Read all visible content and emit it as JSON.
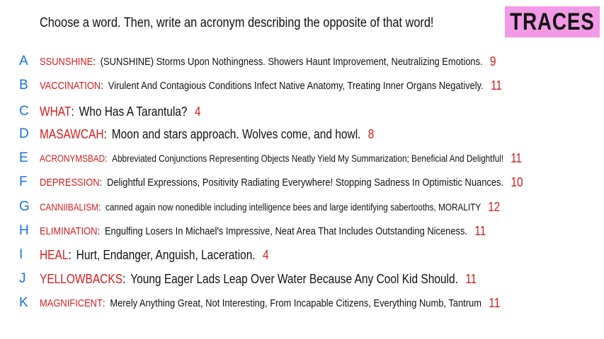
{
  "prompt": "Choose a word. Then, write an acronym describing the opposite of that word!",
  "badge": "TRACES",
  "colors": {
    "letter": "#1673e0",
    "word": "#d81c1c",
    "count": "#d81c1c",
    "badge_bg": "#f29ae6",
    "text": "#111111"
  },
  "rows": [
    {
      "letter": "A",
      "word": "SSUNSHINE",
      "text": "(SUNSHINE) Storms Upon Nothingness. Showers Haunt Improvement, Neutralizing Emotions.",
      "count": "9"
    },
    {
      "letter": "B",
      "word": "VACCINATION",
      "text": "Virulent And Contagious Conditions Infect Native Anatomy, Treating Inner Organs Negatively.",
      "count": "11"
    },
    {
      "letter": "C",
      "word": "WHAT",
      "text": "Who Has A Tarantula?",
      "count": "4"
    },
    {
      "letter": "D",
      "word": "MASAWCAH",
      "text": "Moon and stars approach. Wolves come, and howl.",
      "count": "8"
    },
    {
      "letter": "E",
      "word": "ACRONYMSBAD",
      "text": "Abbreviated Conjunctions Representing Objects Neatly Yield My Summarization; Beneficial And Delightful!",
      "count": "11"
    },
    {
      "letter": "F",
      "word": "DEPRESSION",
      "text": "Delightful Expressions, Positivity Radiating Everywhere! Stopping Sadness In Optimistic Nuances.",
      "count": "10"
    },
    {
      "letter": "G",
      "word": "CANNIIBALISM",
      "text": "canned again now nonedible including intelligence bees and large identifying sabertooths, MORALITY",
      "count": "12"
    },
    {
      "letter": "H",
      "word": "ELIMINATION",
      "text": "Engulfing Losers In Michael's Impressive, Neat Area That Includes Outstanding Niceness.",
      "count": "11"
    },
    {
      "letter": "I",
      "word": "HEAL",
      "text": "Hurt, Endanger, Anguish, Laceration.",
      "count": "4"
    },
    {
      "letter": "J",
      "word": "YELLOWBACKS",
      "text": "Young Eager Lads Leap Over Water Because Any Cool Kid Should.",
      "count": "11"
    },
    {
      "letter": "K",
      "word": "MAGNIFICENT",
      "text": "Merely Anything Great, Not Interesting, From Incapable Citizens, Everything Numb, Tantrum",
      "count": "11"
    }
  ]
}
